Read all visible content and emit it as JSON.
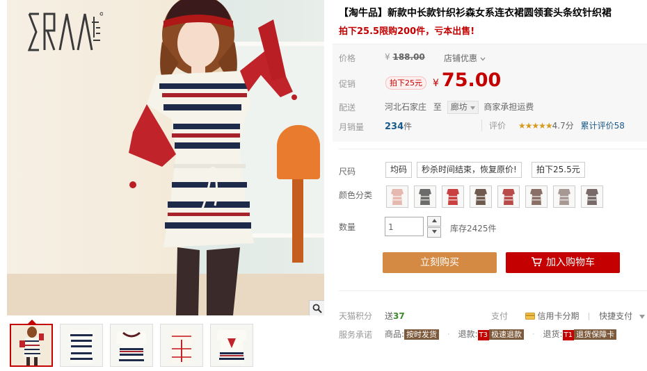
{
  "product": {
    "title": "【淘牛品】新款中长款针织衫森女系连衣裙圆领套头条纹针织裙",
    "subtitle": "拍下25.5限购200件，亏本出售!"
  },
  "pricing": {
    "price_label": "价格",
    "original_price_currency": "¥",
    "original_price": "188.00",
    "shop_offer_label": "店铺优惠",
    "promo_label": "促销",
    "promo_tag": "拍下25元",
    "promo_currency": "¥",
    "promo_price": "75.00",
    "shipping_label": "配送",
    "ship_from": "河北石家庄",
    "ship_to_prefix": "至",
    "ship_to": "廊坊",
    "shipping_fee": "商家承担运费",
    "sales_label": "月销量",
    "sales_count": "234",
    "sales_unit": "件",
    "rating_label": "评价",
    "rating_stars": "★★★★★",
    "rating_score": "4.7分",
    "review_count_text": "累计评价58"
  },
  "options": {
    "size_label": "尺码",
    "size_values": [
      "均码",
      "秒杀时间结束，恢复原价!",
      "拍下25.5元"
    ],
    "color_label": "颜色分类",
    "color_swatches": [
      "#e6b9b0",
      "#6b6b6b",
      "#c84040",
      "#6f5a50",
      "#b84a4a",
      "#8a6f66",
      "#a89894",
      "#776a68"
    ],
    "quantity_label": "数量",
    "quantity_value": "1",
    "stock_text": "库存2425件"
  },
  "actions": {
    "buy_now": "立刻购买",
    "add_to_cart": "加入购物车"
  },
  "extras": {
    "points_label": "天猫积分",
    "points_prefix": "送",
    "points_value": "37",
    "payment_label": "支付",
    "credit_card": "信用卡分期",
    "quick_pay": "快捷支付",
    "service_label": "服务承诺",
    "svc_goods_prefix": "商品:",
    "svc_goods_badge": "按时发货",
    "svc_refund_prefix": "退款:",
    "svc_refund_code": "T3",
    "svc_refund_badge": "极速退款",
    "svc_return_prefix": "退货:",
    "svc_return_code": "T1",
    "svc_return_badge": "退货保障卡"
  },
  "colors": {
    "accent_red": "#c40000",
    "buy_button": "#d58a44",
    "cart_button": "#c40000"
  },
  "icons": [
    "zoom-icon",
    "cart-icon",
    "credit-card-icon",
    "chevron-down-icon",
    "caret-up-icon",
    "caret-down-icon"
  ]
}
